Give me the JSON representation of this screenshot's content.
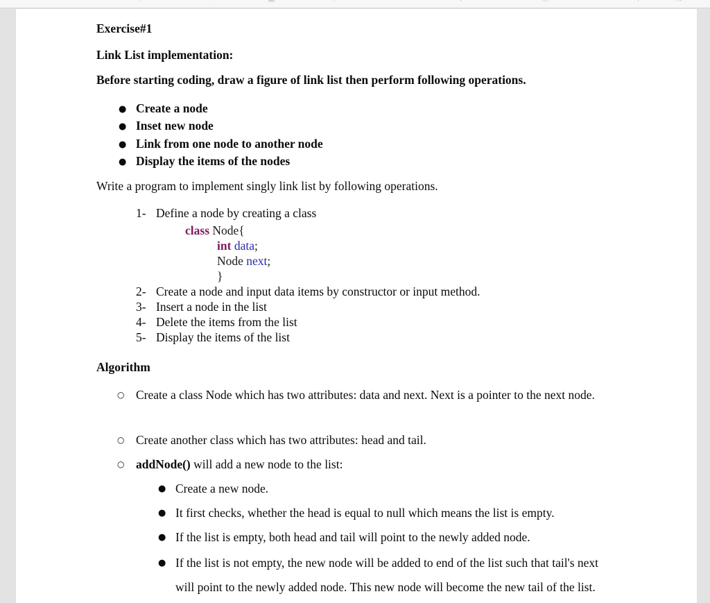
{
  "viewer": {
    "toolbar_icons": [
      "rotate-icon",
      "zoom-out-icon",
      "page-fit-icon",
      "zoom-in-icon",
      "download-icon",
      "print-icon",
      "more-icon",
      "fullscreen-icon"
    ]
  },
  "document": {
    "exercise_heading": "Exercise#1",
    "title_heading": "Link List implementation:",
    "intro_heading": "Before starting coding, draw a figure of link list then perform following operations.",
    "operations": [
      "Create a node",
      "Inset new node",
      "Link from one node to another node",
      "Display the items of the nodes"
    ],
    "write_program_line": "Write a program to implement singly link list by following operations.",
    "steps": [
      {
        "num": "1-",
        "text": "Define a node by creating a class"
      },
      {
        "num": "2-",
        "text": "Create a node and input data items by constructor or input method."
      },
      {
        "num": "3-",
        "text": "Insert a node in the list"
      },
      {
        "num": "4-",
        "text": "Delete the items from the list"
      },
      {
        "num": "5-",
        "text": "Display the items of the list"
      }
    ],
    "code": {
      "line1_kw": "class",
      "line1_rest": " Node{",
      "line2_kw": "int",
      "line2_id": "data",
      "line2_semi": ";",
      "line3_type": "Node ",
      "line3_id": "next",
      "line3_semi": ";",
      "line4": "}"
    },
    "algorithm_heading": "Algorithm",
    "algorithm_items": [
      {
        "marker": "o",
        "text": "Create a class Node which has two attributes: data and next. Next is a pointer to the next node."
      },
      {
        "marker": "o",
        "text": "Create another class which has two attributes: head and tail."
      }
    ],
    "addnode_bold": "addNode()",
    "addnode_rest": " will add a new node to the list:",
    "addnode_bullets": [
      "Create a new node.",
      "It first checks, whether the head is equal to null which means the list is empty.",
      "If the list is empty, both head and tail will point to the newly added node.",
      "If the list is not empty, the new node will be added to end of the list such that tail's next will point to the newly added node. This new node will become the new tail of the list."
    ]
  },
  "colors": {
    "keyword": "#7d1b5d",
    "identifier": "#2a2aa5",
    "text": "#0b0b0b",
    "page_background": "#ffffff",
    "viewer_background": "#e3e3e3"
  }
}
